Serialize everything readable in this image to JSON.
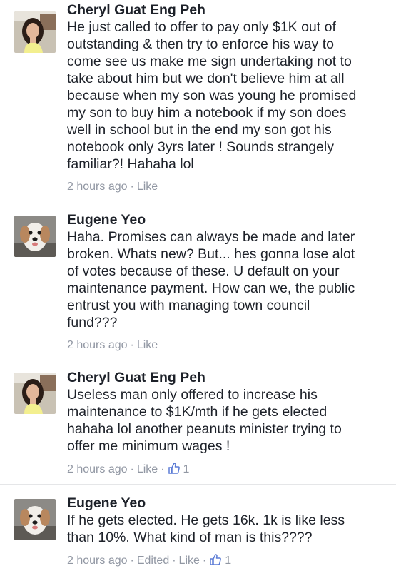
{
  "comments": [
    {
      "author": "Cheryl Guat Eng Peh",
      "avatar": "woman-portrait-avatar",
      "lines": [
        "He just called to offer to pay only $1K out of",
        "outstanding & then try to enforce his way to",
        "come see us make me sign undertaking not to",
        "take about him but we don't believe him at all",
        "because when my son was young he promised",
        "my son to buy him a notebook if my son does",
        "well in school but in the end my son got his",
        "notebook only 3yrs later !  Sounds strangely",
        "familiar?!  Hahaha lol"
      ],
      "time": "2 hours ago",
      "sep": "·",
      "like_label": "Like"
    },
    {
      "author": "Eugene Yeo",
      "avatar": "dog-avatar",
      "lines": [
        "Haha. Promises can always be made and later",
        "broken. Whats new? But... hes gonna lose alot",
        "of votes because of these. U default on your",
        "maintenance payment. How can we, the public",
        "entrust you with managing town council",
        "fund???"
      ],
      "time": "2 hours ago",
      "sep": "·",
      "like_label": "Like"
    },
    {
      "author": "Cheryl Guat Eng Peh",
      "avatar": "woman-portrait-avatar",
      "lines": [
        "Useless man only offered to increase his",
        "maintenance to $1K/mth if he gets elected",
        "hahaha lol another peanuts minister trying to",
        "offer me minimum wages !"
      ],
      "time": "2 hours ago",
      "sep": "·",
      "like_label": "Like",
      "like_count": "1"
    },
    {
      "author": "Eugene Yeo",
      "avatar": "dog-avatar",
      "lines": [
        "If he gets elected. He gets 16k. 1k is like less",
        "than 10%. What kind of man is this????"
      ],
      "time": "2 hours ago",
      "sep": "·",
      "edited_label": "Edited",
      "like_label": "Like",
      "like_count": "1"
    }
  ],
  "colors": {
    "text": "#1d2129",
    "meta": "#9197a3",
    "like_icon": "#5b7bd5",
    "divider": "#e5e6e8"
  }
}
